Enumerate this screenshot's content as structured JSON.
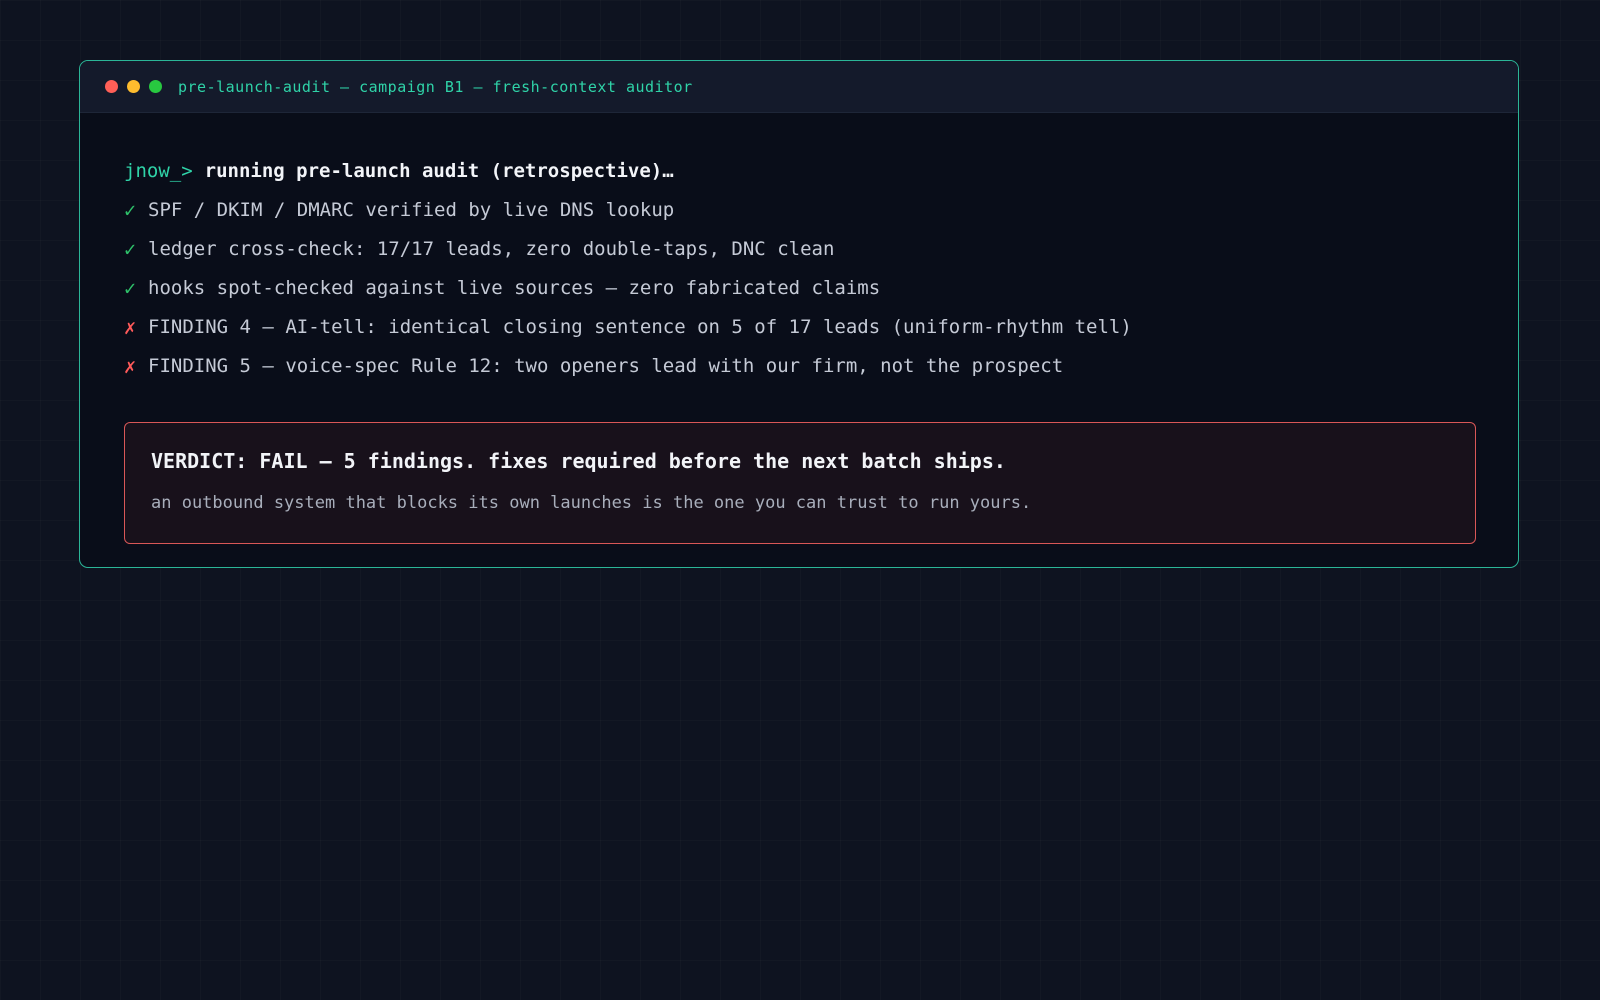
{
  "window": {
    "title": "pre-launch-audit — campaign B1 — fresh-context auditor",
    "controls": {
      "close_color": "#ff5f57",
      "minimize_color": "#febc2e",
      "maximize_color": "#28c840"
    }
  },
  "terminal": {
    "prompt": "jnow_>",
    "command": "running pre-launch audit (retrospective)…",
    "checks": [
      {
        "status": "pass",
        "mark": "✓",
        "text": "SPF / DKIM / DMARC verified by live DNS lookup"
      },
      {
        "status": "pass",
        "mark": "✓",
        "text": "ledger cross-check: 17/17 leads, zero double-taps, DNC clean"
      },
      {
        "status": "pass",
        "mark": "✓",
        "text": "hooks spot-checked against live sources — zero fabricated claims"
      },
      {
        "status": "fail",
        "mark": "✗",
        "text": "FINDING 4 — AI-tell: identical closing sentence on 5 of 17 leads (uniform-rhythm tell)"
      },
      {
        "status": "fail",
        "mark": "✗",
        "text": "FINDING 5 — voice-spec Rule 12: two openers lead with our firm, not the prospect"
      }
    ],
    "verdict": {
      "headline_bold": "VERDICT: FAIL — 5 findings.",
      "headline_rest": "fixes required before the next batch ships.",
      "tagline": "an outbound system that blocks its own launches is the one you can trust to run yours."
    }
  },
  "colors": {
    "accent": "#2fd3a8",
    "pass": "#2ec26a",
    "fail": "#ff5a5a",
    "verdict_border": "#d95757"
  }
}
